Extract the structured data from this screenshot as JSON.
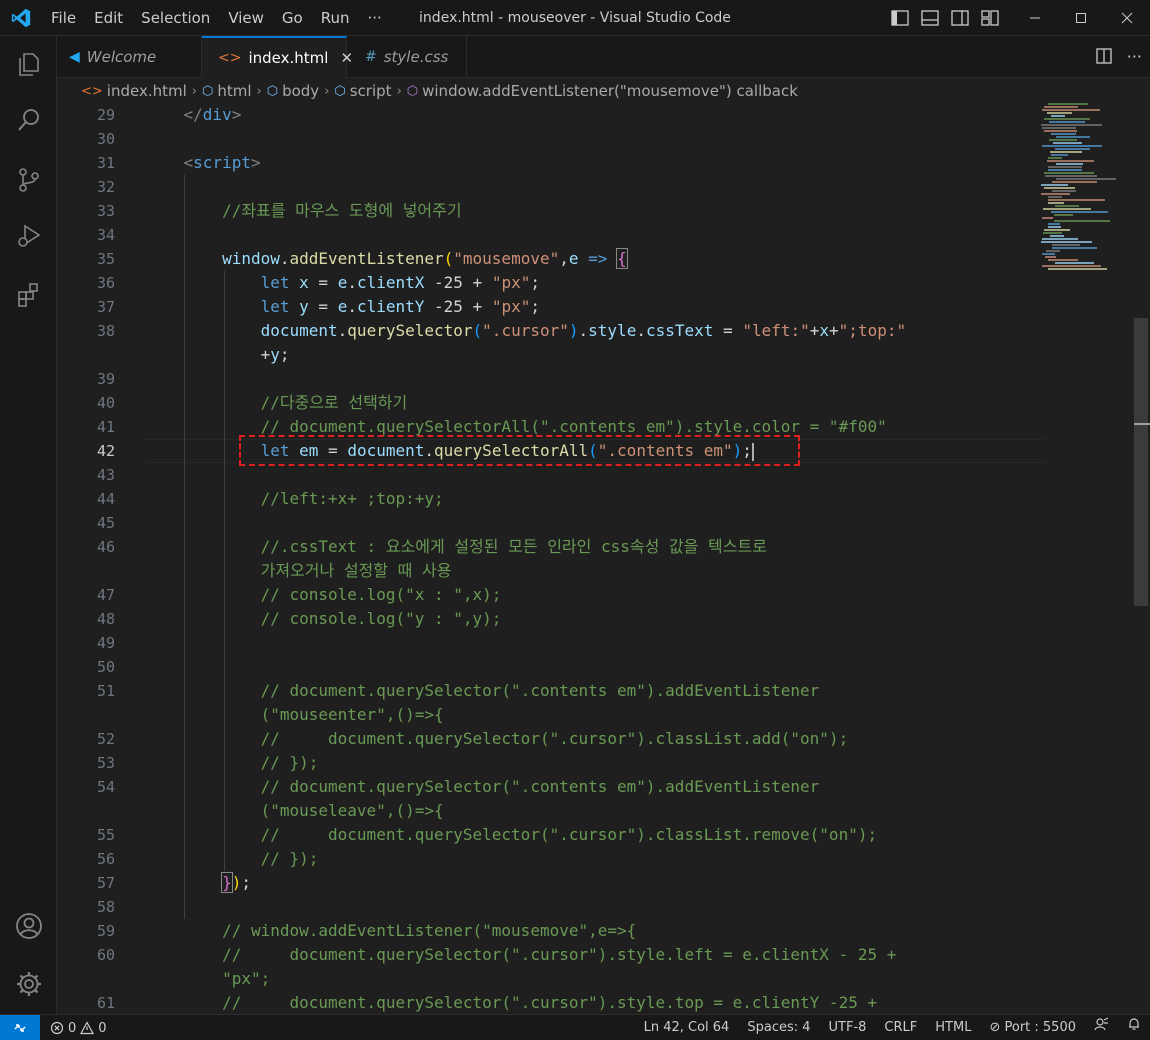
{
  "window": {
    "title": "index.html - mouseover - Visual Studio Code",
    "menu": [
      "File",
      "Edit",
      "Selection",
      "View",
      "Go",
      "Run",
      "···"
    ]
  },
  "tabs": [
    {
      "label": "Welcome",
      "icon": "vscode-logo-icon",
      "state": "inactive"
    },
    {
      "label": "index.html",
      "icon": "html-icon",
      "state": "active",
      "close": "✕"
    },
    {
      "label": "style.css",
      "icon": "css-hash-icon",
      "state": "inactive"
    }
  ],
  "breadcrumbs": [
    "index.html",
    "html",
    "body",
    "script",
    "window.addEventListener(\"mousemove\") callback"
  ],
  "editor": {
    "current_line": 42,
    "line_numbers": [
      "29",
      "30",
      "31",
      "32",
      "33",
      "34",
      "35",
      "36",
      "37",
      "38",
      "",
      "39",
      "40",
      "41",
      "42",
      "43",
      "44",
      "45",
      "46",
      "",
      "47",
      "48",
      "49",
      "50",
      "51",
      "",
      "52",
      "53",
      "54",
      "",
      "55",
      "56",
      "57",
      "58",
      "59",
      "60",
      "",
      "61"
    ],
    "code_lines": [
      "    </div>",
      "",
      "    <script>",
      "",
      "        //좌표를 마우스 도형에 넣어주기",
      "",
      "        window.addEventListener(\"mousemove\",e => {",
      "            let x = e.clientX -25 + \"px\";",
      "            let y = e.clientY -25 + \"px\";",
      "            document.querySelector(\".cursor\").style.cssText = \"left:\"+x+\";top:\"",
      "            +y;",
      "",
      "            //다중으로 선택하기",
      "            // document.querySelectorAll(\".contents em\").style.color = \"#f00\"",
      "            let em = document.querySelectorAll(\".contents em\");",
      "",
      "            //left:+x+ ;top:+y;",
      "",
      "            //.cssText : 요소에게 설정된 모든 인라인 css속성 값을 텍스트로",
      "            가져오거나 설정할 때 사용",
      "            // console.log(\"x : \",x);",
      "            // console.log(\"y : \",y);",
      "",
      "",
      "            // document.querySelector(\".contents em\").addEventListener",
      "            (\"mouseenter\",()=>{",
      "            //     document.querySelector(\".cursor\").classList.add(\"on\");",
      "            // });",
      "            // document.querySelector(\".contents em\").addEventListener",
      "            (\"mouseleave\",()=>{",
      "            //     document.querySelector(\".cursor\").classList.remove(\"on\");",
      "            // });",
      "        });",
      "",
      "        // window.addEventListener(\"mousemove\",e=>{",
      "        //     document.querySelector(\".cursor\").style.left = e.clientX - 25 +",
      "        \"px\";",
      "        //     document.querySelector(\".cursor\").style.top = e.clientY -25 +"
    ]
  },
  "statusbar": {
    "problems": "0",
    "warnings": "0",
    "position": "Ln 42, Col 64",
    "spaces": "Spaces: 4",
    "encoding": "UTF-8",
    "eol": "CRLF",
    "language": "HTML",
    "port": "Port : 5500"
  },
  "colors": {
    "accent": "#0078d4",
    "highlight_box": "#e02020"
  }
}
